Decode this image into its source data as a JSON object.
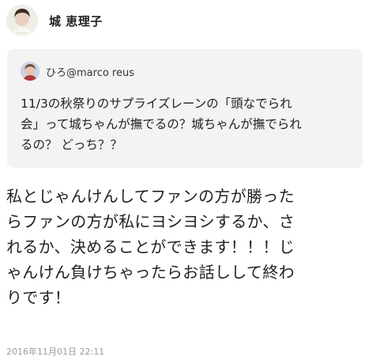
{
  "author": {
    "name": "城 恵理子",
    "avatar_icon": "user-avatar-icon"
  },
  "quoted_post": {
    "user": "ひろ@marco reus",
    "avatar_icon": "user-avatar-icon",
    "background": "#f3f3f3",
    "text": "11/3の秋祭りのサプライズレーンの「頭なでられ\n会」って城ちゃんが撫でるの？城ちゃんが撫でられ\nるの？ どっち？？"
  },
  "post": {
    "body": "私とじゃんけんしてファンの方が勝った\nらファンの方が私にヨシヨシするか、さ\nれるか、決めることができます！！！じ\nゃんけん負けちゃったらお話しして終わ\nりです！",
    "timestamp": "2016年11月01日 22:11"
  }
}
